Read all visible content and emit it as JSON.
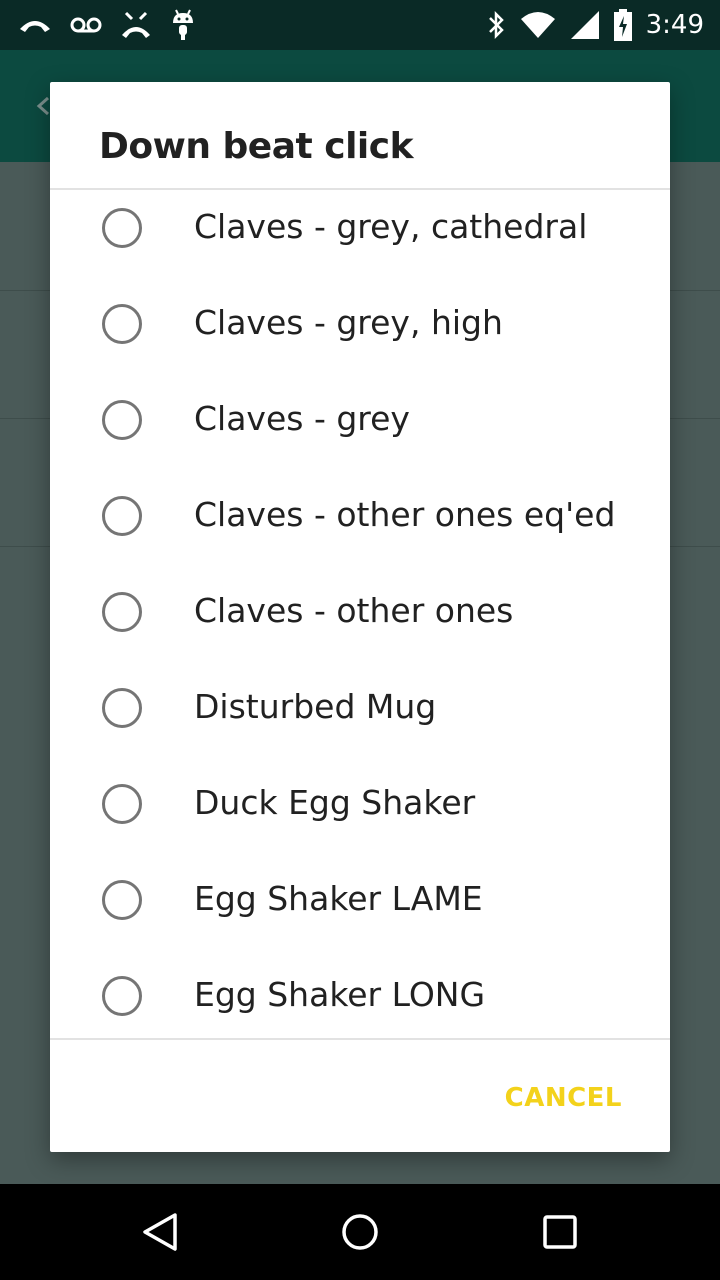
{
  "status_bar": {
    "time": "3:49",
    "left_icons": [
      "missed-call-icon",
      "voicemail-icon",
      "call-end-icon",
      "android-icon"
    ],
    "right_icons": [
      "bluetooth-icon",
      "wifi-icon",
      "cell-signal-icon",
      "battery-charging-icon"
    ]
  },
  "dialog": {
    "title": "Down beat click",
    "options": [
      {
        "label": "Claves - grey, cathedral",
        "selected": false
      },
      {
        "label": "Claves - grey, high",
        "selected": false
      },
      {
        "label": "Claves - grey",
        "selected": false
      },
      {
        "label": "Claves - other ones eq'ed",
        "selected": false
      },
      {
        "label": "Claves - other ones",
        "selected": false
      },
      {
        "label": "Disturbed Mug",
        "selected": false
      },
      {
        "label": "Duck Egg Shaker",
        "selected": false
      },
      {
        "label": "Egg Shaker LAME",
        "selected": false
      },
      {
        "label": "Egg Shaker LONG",
        "selected": false
      }
    ],
    "cancel_label": "CANCEL"
  },
  "colors": {
    "accent": "#f3d21b",
    "status_bar_bg": "#0a2a26",
    "toolbar_bg": "#0c4a40",
    "radio_border": "#757575"
  },
  "nav_bar": {
    "buttons": [
      "back-icon",
      "home-icon",
      "recents-icon"
    ]
  }
}
